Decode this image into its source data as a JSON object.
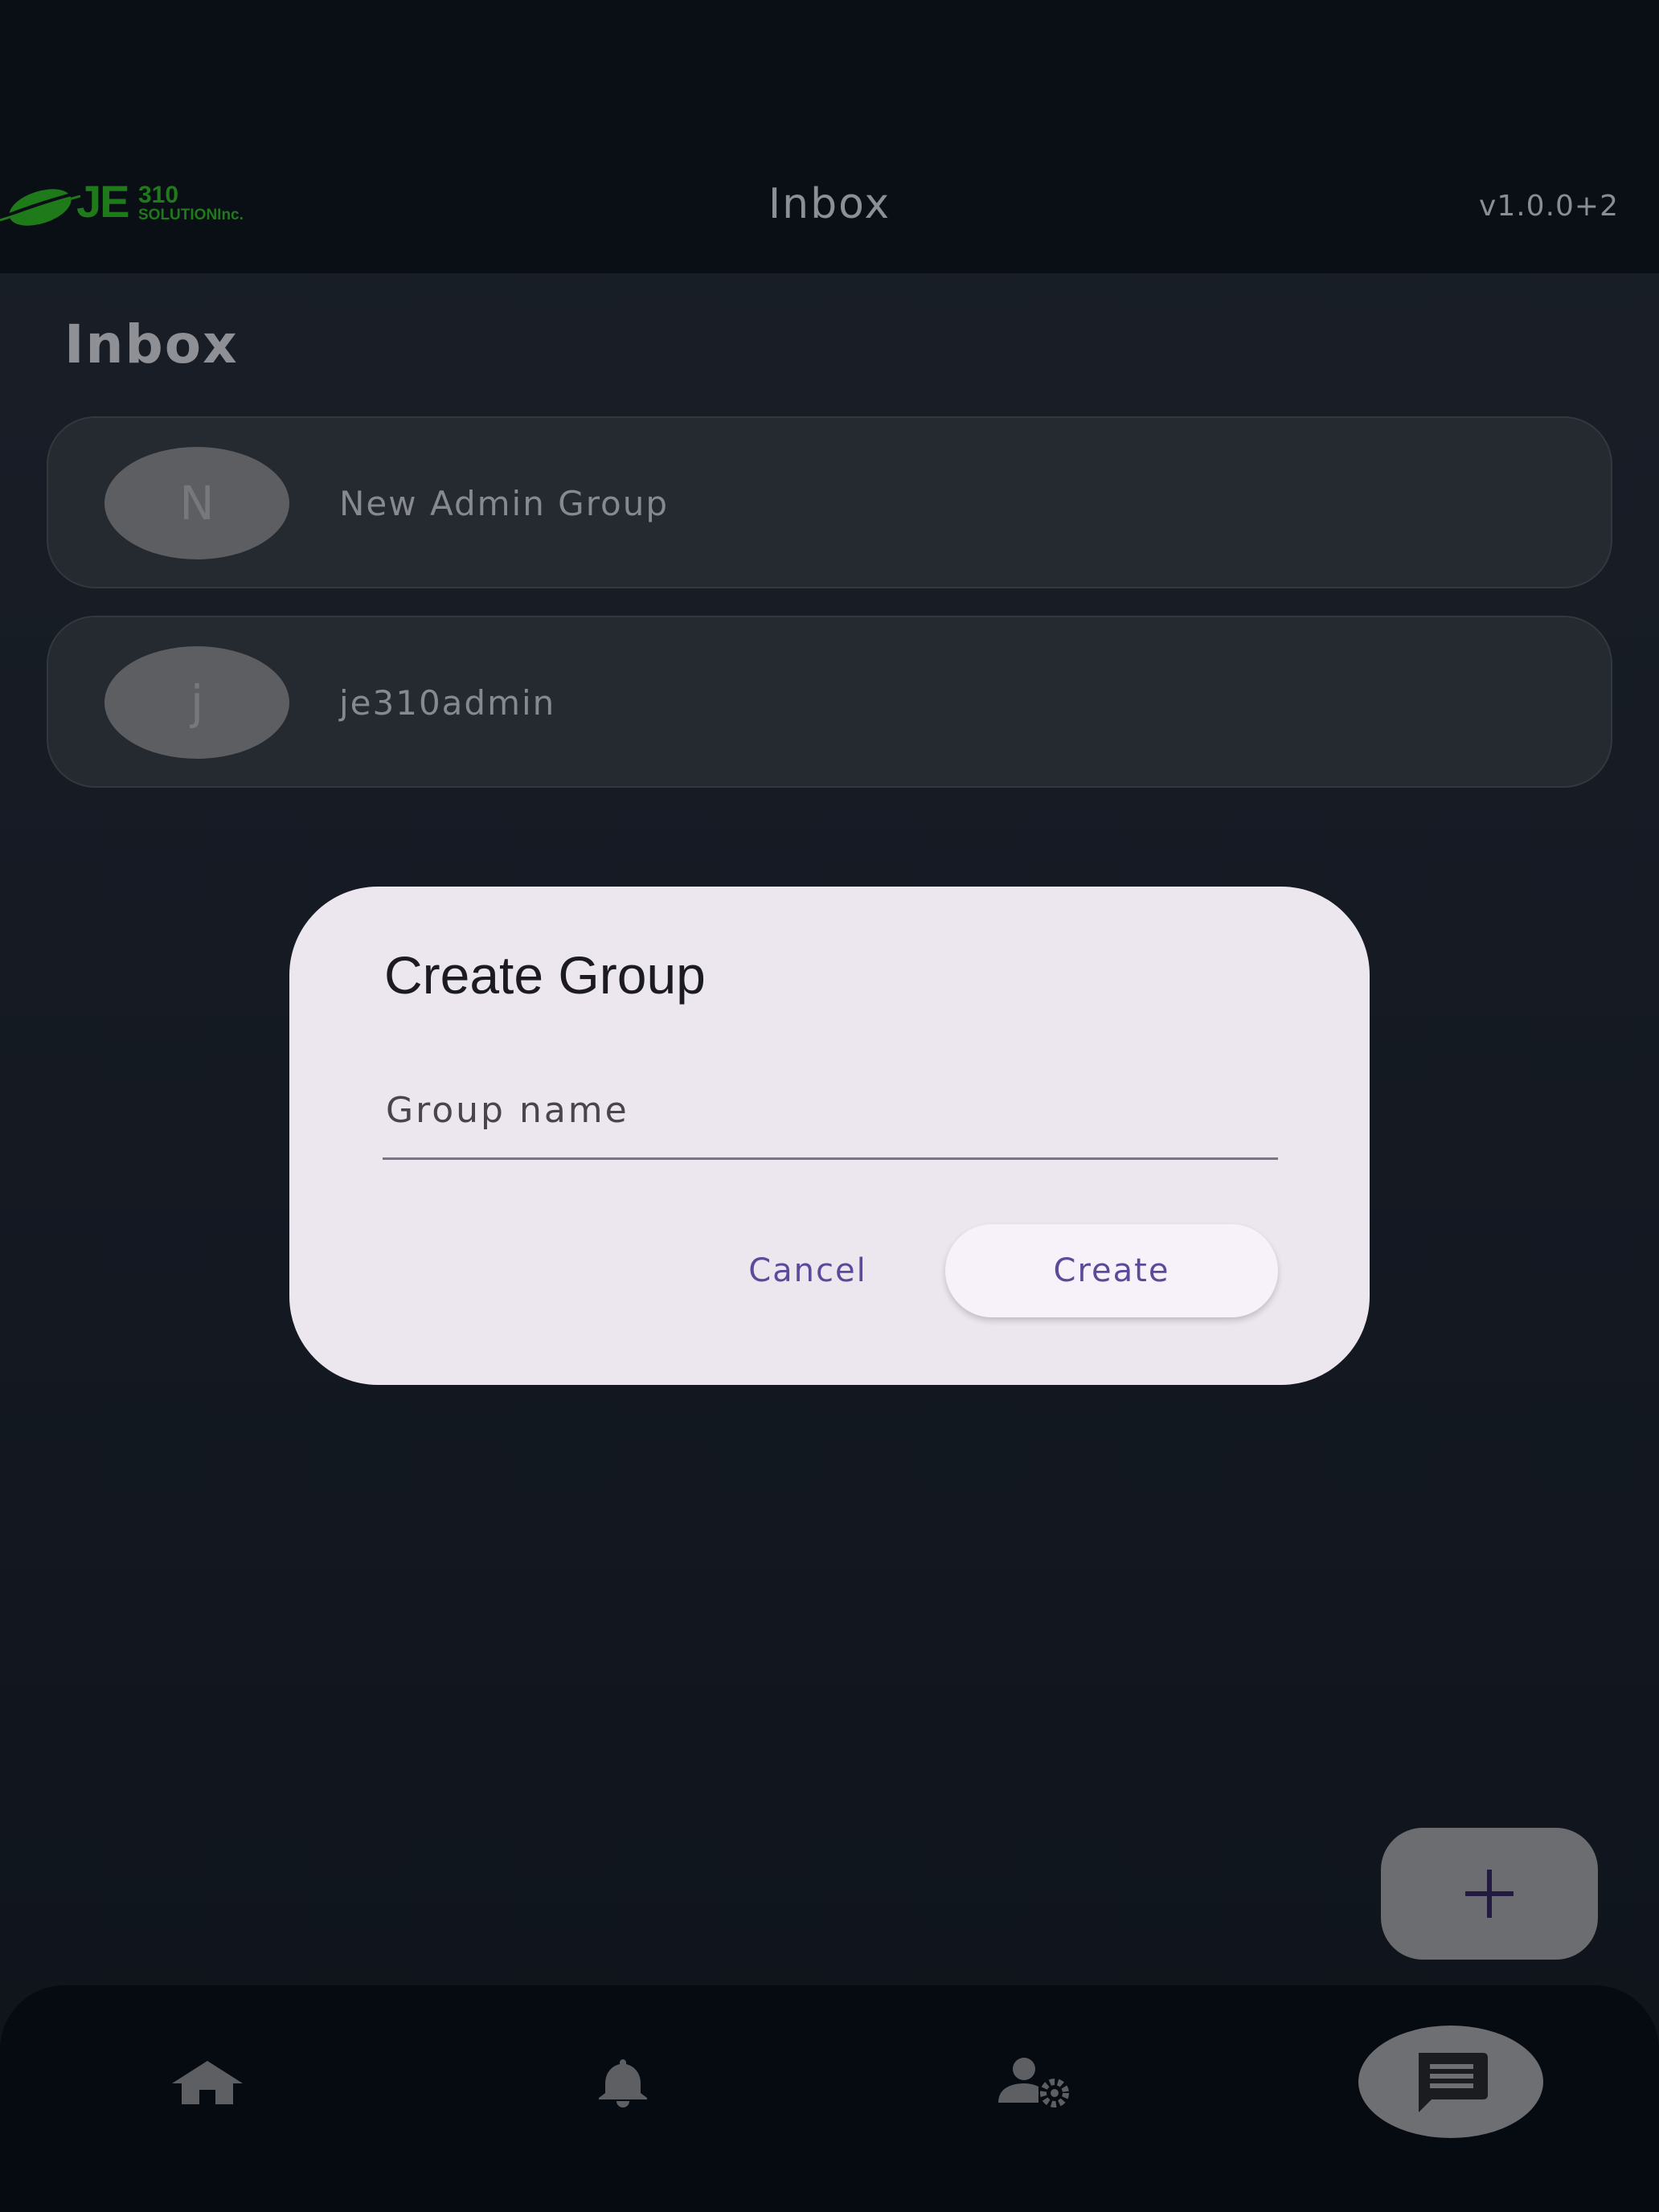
{
  "appbar": {
    "logo_alt": "JE310 SOLUTION Inc.",
    "logo_je": "JE",
    "logo_number": "310",
    "logo_subtitle": "SOLUTIONInc.",
    "title": "Inbox",
    "version": "v1.0.0+2"
  },
  "page": {
    "heading": "Inbox"
  },
  "conversations": [
    {
      "initial": "N",
      "name": "New Admin Group"
    },
    {
      "initial": "j",
      "name": "je310admin"
    }
  ],
  "dialog": {
    "title": "Create Group",
    "input_placeholder": "Group name",
    "input_value": "",
    "cancel_label": "Cancel",
    "create_label": "Create"
  },
  "fab": {
    "icon": "plus-icon"
  },
  "bottom_nav": {
    "items": [
      {
        "icon": "home-icon",
        "active": false
      },
      {
        "icon": "bell-icon",
        "active": false
      },
      {
        "icon": "user-settings-icon",
        "active": false
      },
      {
        "icon": "chat-icon",
        "active": true
      }
    ]
  },
  "colors": {
    "brand_green": "#1f7a1a",
    "dialog_surface": "#ece6ef",
    "accent_purple": "#5b4a9a",
    "app_bar": "#0a0e15",
    "nav_bar": "#060a11"
  }
}
